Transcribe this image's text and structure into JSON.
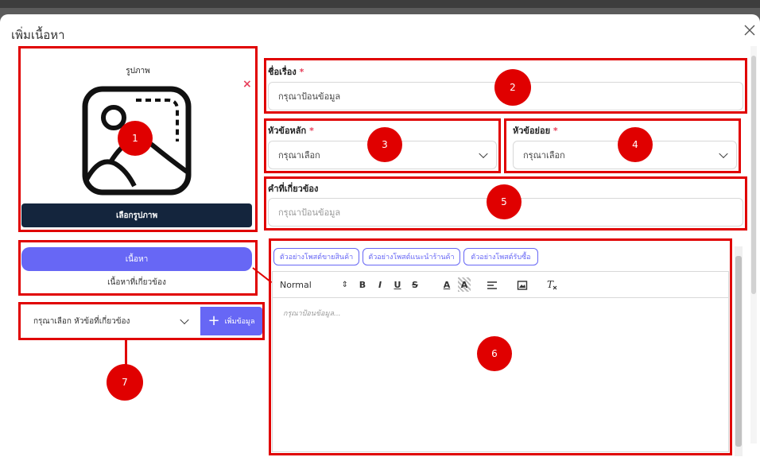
{
  "dialog": {
    "title": "เพิ่มเนื้อหา",
    "close_icon": "close-icon"
  },
  "image_panel": {
    "label": "รูปภาพ",
    "remove_icon": "×",
    "choose_button": "เลือกรูปภาพ",
    "marker": "1"
  },
  "title_field": {
    "label": "ชื่อเรื่อง",
    "required": "*",
    "placeholder": "กรุณาป้อนข้อมูล",
    "marker": "2"
  },
  "main_topic": {
    "label": "หัวข้อหลัก",
    "required": "*",
    "value": "กรุณาเลือก",
    "marker": "3"
  },
  "sub_topic": {
    "label": "หัวข้อย่อย",
    "required": "*",
    "value": "กรุณาเลือก",
    "marker": "4"
  },
  "keywords": {
    "label": "คำที่เกี่ยวข้อง",
    "placeholder": "กรุณาป้อนข้อมูล",
    "marker": "5"
  },
  "content_tabs": {
    "active": "เนื้อหา",
    "inactive": "เนื้อหาที่เกี่ยวข้อง"
  },
  "editor": {
    "templates": [
      "ตัวอย่างโพสต์ขายสินค้า",
      "ตัวอย่างโพสต์แนะนำร้านค้า",
      "ตัวอย่างโพสต์รับซื้อ"
    ],
    "format": "Normal",
    "format_arrows": "⇕",
    "bold": "B",
    "italic": "I",
    "underline": "U",
    "strike": "S",
    "color": "A",
    "background": "A",
    "placeholder": "กรุณาป้อนข้อมูล...",
    "marker": "6"
  },
  "related": {
    "select": "กรุณาเลือก หัวข้อที่เกี่ยวข้อง",
    "plus": "+",
    "add_button": "เพิ่มข้อมูล",
    "marker": "7"
  },
  "colors": {
    "accent": "#6767f5",
    "dark": "#14253d",
    "annotation": "#e00000"
  }
}
